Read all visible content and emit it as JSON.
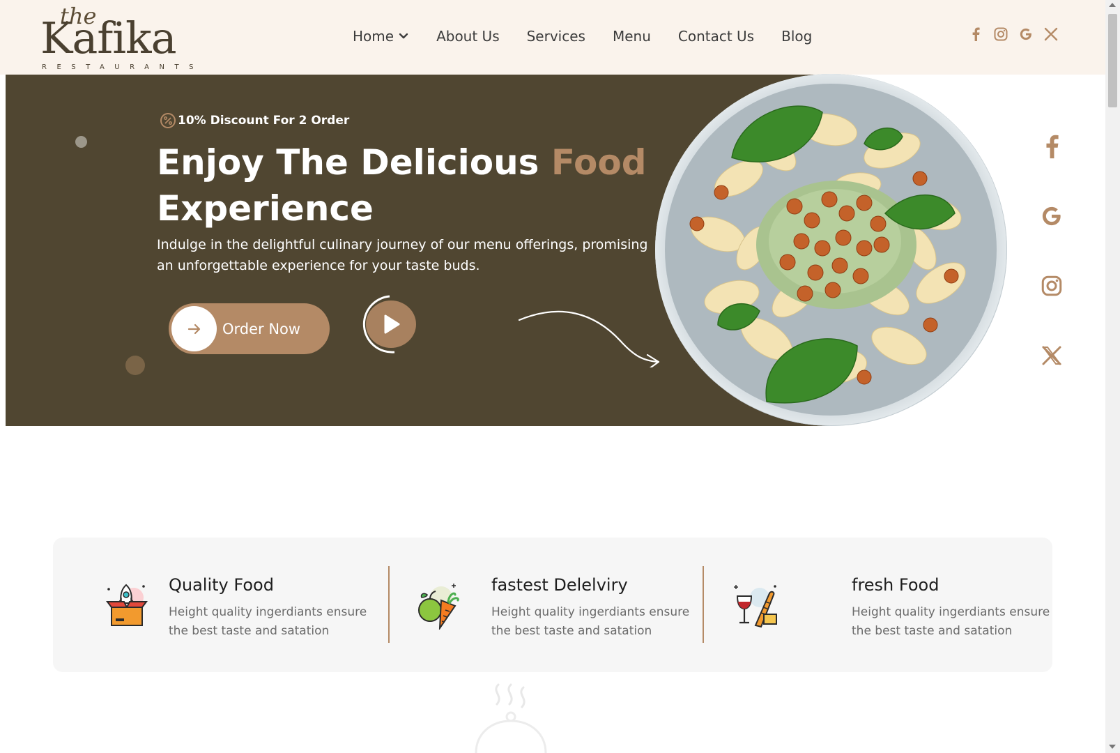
{
  "header": {
    "logo": {
      "script": "the",
      "name": "Kafika",
      "tagline": "RESTAURANTS"
    },
    "nav": [
      {
        "label": "Home",
        "has_dropdown": true
      },
      {
        "label": "About Us"
      },
      {
        "label": "Services"
      },
      {
        "label": "Menu"
      },
      {
        "label": "Contact Us"
      },
      {
        "label": "Blog"
      }
    ],
    "social_icons": [
      "facebook-icon",
      "instagram-icon",
      "google-icon",
      "x-icon"
    ]
  },
  "hero": {
    "discount_text": "10% Discount For 2 Order",
    "title_part1": "Enjoy The Delicious ",
    "title_accent": "Food",
    "title_part2": "Experience",
    "description": "Indulge in the delightful culinary journey of our menu offerings, promising an unforgettable experience for your taste buds.",
    "order_button": "Order Now"
  },
  "side_social": [
    "facebook-icon",
    "google-icon",
    "instagram-icon",
    "x-icon"
  ],
  "features": [
    {
      "title": "Quality Food",
      "description": "Height quality ingerdiants ensure the best taste and satation",
      "icon": "rocket-box-icon"
    },
    {
      "title": "fastest Delelviry",
      "description": "Height quality ingerdiants ensure the best taste and satation",
      "icon": "vegetables-icon"
    },
    {
      "title": "fresh Food",
      "description": "Height quality ingerdiants ensure the best taste and satation",
      "icon": "wine-bread-icon"
    }
  ],
  "colors": {
    "accent": "#b48a66",
    "hero_bg": "#504631",
    "header_bg": "#faf3ec",
    "features_bg": "#f6f6f6"
  }
}
